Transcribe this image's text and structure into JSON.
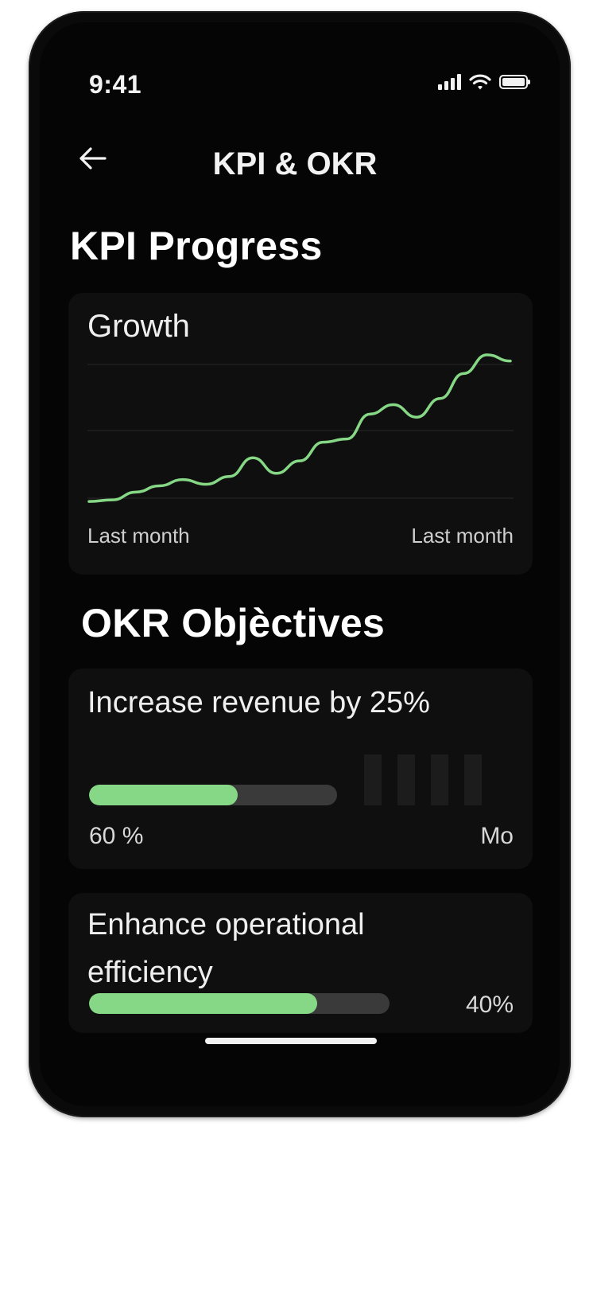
{
  "status": {
    "time": "9:41",
    "signal_icon": "signal-bars-icon",
    "wifi_icon": "wifi-icon",
    "battery_icon": "battery-icon"
  },
  "nav": {
    "back_icon": "arrow-left-icon",
    "title": "KPI & OKR"
  },
  "kpi": {
    "section_title": "KPI Progress",
    "card_title": "Growth",
    "x_start_label": "Last month",
    "x_end_label": "Last month",
    "line_color": "#86d886"
  },
  "chart_data": {
    "type": "line",
    "title": "Growth",
    "xlabel": "",
    "ylabel": "",
    "x_tick_labels": [
      "Last month",
      "Last month"
    ],
    "grid": true,
    "ylim": [
      0,
      100
    ],
    "series": [
      {
        "values": [
          2,
          3,
          8,
          12,
          16,
          13,
          18,
          30,
          20,
          28,
          40,
          42,
          58,
          64,
          56,
          68,
          84,
          96,
          92
        ]
      }
    ]
  },
  "okr": {
    "section_title": "OKR Objèctives",
    "objectives": [
      {
        "title": "Increase revenue by 25%",
        "progress": 0.6,
        "progress_label": "60 %",
        "extra_label": "Mo"
      },
      {
        "title_line1": "Enhance operational",
        "title_line2": "efficiency",
        "progress": 0.76,
        "progress_label": "40%"
      }
    ]
  }
}
